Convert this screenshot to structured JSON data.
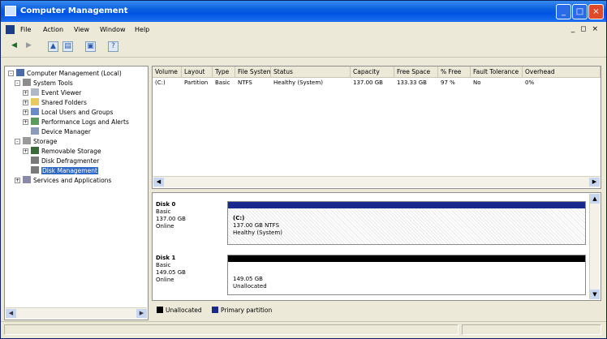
{
  "window": {
    "title": "Computer Management",
    "controls": [
      "_",
      "□",
      "×"
    ]
  },
  "menu": {
    "items": [
      "File",
      "Action",
      "View",
      "Window",
      "Help"
    ],
    "right_controls": "_ ◻ ×"
  },
  "toolbar": {
    "icons": [
      "back-icon",
      "forward-icon",
      "up-icon",
      "show-hide-tree-icon",
      "properties-icon",
      "help-icon"
    ]
  },
  "tree": {
    "items": [
      {
        "label": "Computer Management (Local)",
        "level": 0,
        "expander": "-"
      },
      {
        "label": "System Tools",
        "level": 1,
        "expander": "-"
      },
      {
        "label": "Event Viewer",
        "level": 2,
        "expander": "+"
      },
      {
        "label": "Shared Folders",
        "level": 2,
        "expander": "+"
      },
      {
        "label": "Local Users and Groups",
        "level": 2,
        "expander": "+"
      },
      {
        "label": "Performance Logs and Alerts",
        "level": 2,
        "expander": "+"
      },
      {
        "label": "Device Manager",
        "level": 2,
        "expander": ""
      },
      {
        "label": "Storage",
        "level": 1,
        "expander": "-"
      },
      {
        "label": "Removable Storage",
        "level": 2,
        "expander": "+"
      },
      {
        "label": "Disk Defragmenter",
        "level": 2,
        "expander": ""
      },
      {
        "label": "Disk Management",
        "level": 2,
        "expander": "",
        "selected": true
      },
      {
        "label": "Services and Applications",
        "level": 1,
        "expander": "+"
      }
    ]
  },
  "volumes": {
    "columns": [
      "Volume",
      "Layout",
      "Type",
      "File System",
      "Status",
      "Capacity",
      "Free Space",
      "% Free",
      "Fault Tolerance",
      "Overhead"
    ],
    "rows": [
      [
        "(C:)",
        "Partition",
        "Basic",
        "NTFS",
        "Healthy (System)",
        "137.00 GB",
        "133.33 GB",
        "97 %",
        "No",
        "0%"
      ]
    ]
  },
  "disks": [
    {
      "name": "Disk 0",
      "type": "Basic",
      "size": "137.00 GB",
      "status": "Online",
      "partition": {
        "title": "(C:)",
        "size_fs": "137.00 GB NTFS",
        "status": "Healthy (System)"
      }
    },
    {
      "name": "Disk 1",
      "type": "Basic",
      "size": "149.05 GB",
      "status": "Online",
      "partition": {
        "title": "",
        "size_fs": "149.05 GB",
        "status": "Unallocated"
      }
    }
  ],
  "legend": {
    "items": [
      {
        "label": "Unallocated",
        "color": "#000000"
      },
      {
        "label": "Primary partition",
        "color": "#1a2a8c"
      }
    ]
  },
  "colors": {
    "primary_partition": "#1a2a8c",
    "unallocated": "#000000",
    "selection": "#316ac5",
    "titlebar": "#0054e3"
  }
}
